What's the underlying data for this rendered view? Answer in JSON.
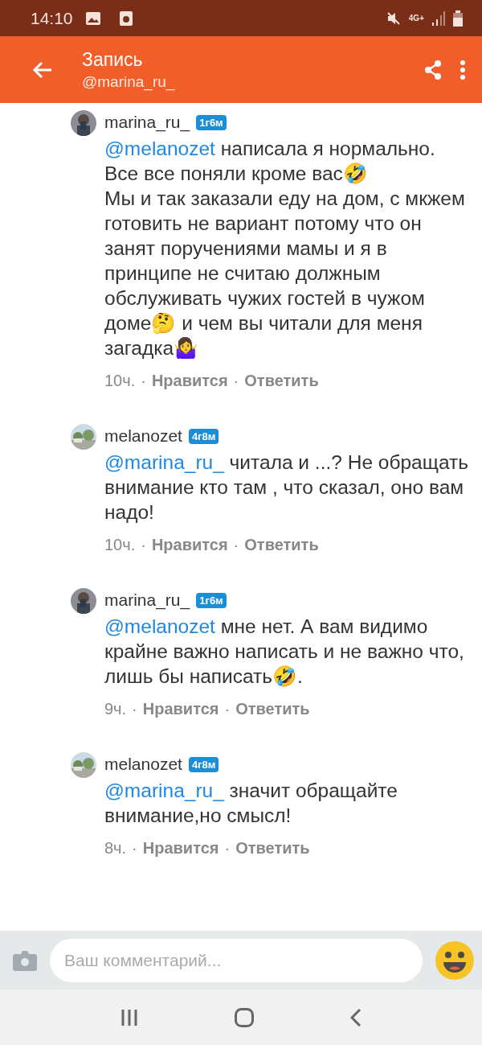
{
  "status_bar": {
    "time": "14:10",
    "network": "4G+"
  },
  "app_bar": {
    "title": "Запись",
    "subtitle": "@marina_ru_"
  },
  "comments": [
    {
      "author": "marina_ru_",
      "badge": "1г6м",
      "mention": "@melanozet",
      "text": " написала я нормально. Все все поняли кроме вас🤣\n Мы и так заказали еду на дом, с мкжем готовить не вариант потому что он занят поручениями мамы и я в принципе не считаю должным обслуживать чужих гостей в чужом доме🤔 и чем вы читали для меня загадка🤷‍♀️",
      "time": "10ч.",
      "sep1": "·",
      "like": "Нравится",
      "sep2": "·",
      "reply": "Ответить"
    },
    {
      "author": "melanozet",
      "badge": "4г8м",
      "mention": "@marina_ru_",
      "text": " читала и ...? Не обращать внимание кто там , что сказал, оно вам надо!",
      "time": "10ч.",
      "sep1": "·",
      "like": "Нравится",
      "sep2": "·",
      "reply": "Ответить"
    },
    {
      "author": "marina_ru_",
      "badge": "1г6м",
      "mention": "@melanozet",
      "text": " мне нет. А вам видимо крайне важно написать и не важно что, лишь бы написать🤣.",
      "time": "9ч.",
      "sep1": "·",
      "like": "Нравится",
      "sep2": "·",
      "reply": "Ответить"
    },
    {
      "author": "melanozet",
      "badge": "4г8м",
      "mention": "@marina_ru_",
      "text": " значит обращайте внимание,но смысл!",
      "time": "8ч.",
      "sep1": "·",
      "like": "Нравится",
      "sep2": "·",
      "reply": "Ответить"
    }
  ],
  "composer": {
    "placeholder": "Ваш комментарий..."
  }
}
